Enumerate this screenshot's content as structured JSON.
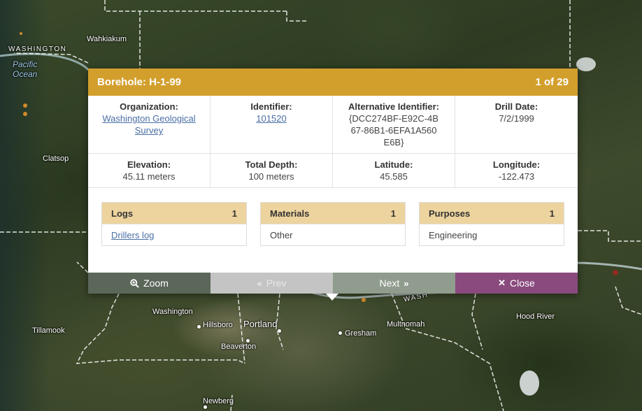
{
  "map": {
    "labels": {
      "washington_state": "WASHINGTON",
      "pacific_ocean": "Pacific\nOcean",
      "wahkiakum": "Wahkiakum",
      "clatsop": "Clatsop",
      "tillamook": "Tillamook",
      "washington_county": "Washington",
      "hillsboro": "Hillsboro",
      "portland": "Portland",
      "beaverton": "Beaverton",
      "gresham": "Gresham",
      "multnomah": "Multnomah",
      "hood_river": "Hood River",
      "newberg": "Newberg",
      "wash_river": "WASH"
    }
  },
  "popup": {
    "title": "Borehole: H-1-99",
    "counter": "1 of 29",
    "fields": {
      "organization": {
        "label": "Organization:",
        "value": "Washington Geological Survey"
      },
      "identifier": {
        "label": "Identifier:",
        "value": "101520"
      },
      "alt_identifier": {
        "label": "Alternative Identifier:",
        "value": "{DCC274BF-E92C-4B67-86B1-6EFA1A560E6B}"
      },
      "drill_date": {
        "label": "Drill Date:",
        "value": "7/2/1999"
      },
      "elevation": {
        "label": "Elevation:",
        "value": "45.11 meters"
      },
      "total_depth": {
        "label": "Total Depth:",
        "value": "100 meters"
      },
      "latitude": {
        "label": "Latitude:",
        "value": "45.585"
      },
      "longitude": {
        "label": "Longitude:",
        "value": "-122.473"
      }
    },
    "cards": {
      "logs": {
        "title": "Logs",
        "count": "1",
        "item": "Drillers log"
      },
      "materials": {
        "title": "Materials",
        "count": "1",
        "item": "Other"
      },
      "purposes": {
        "title": "Purposes",
        "count": "1",
        "item": "Engineering"
      }
    },
    "actions": {
      "zoom": {
        "label": "Zoom",
        "icon": "zoom-in-icon"
      },
      "prev": {
        "label": "Prev",
        "icon": "double-chevron-left-icon"
      },
      "next": {
        "label": "Next",
        "icon": "double-chevron-right-icon"
      },
      "close": {
        "label": "Close",
        "icon": "close-icon"
      }
    },
    "colors": {
      "header": "#d39f2c",
      "card_header": "#edd39e",
      "zoom": "#5b6759",
      "prev": "#c4c4c4",
      "next": "#909c8d",
      "close": "#8a4a7e"
    }
  }
}
